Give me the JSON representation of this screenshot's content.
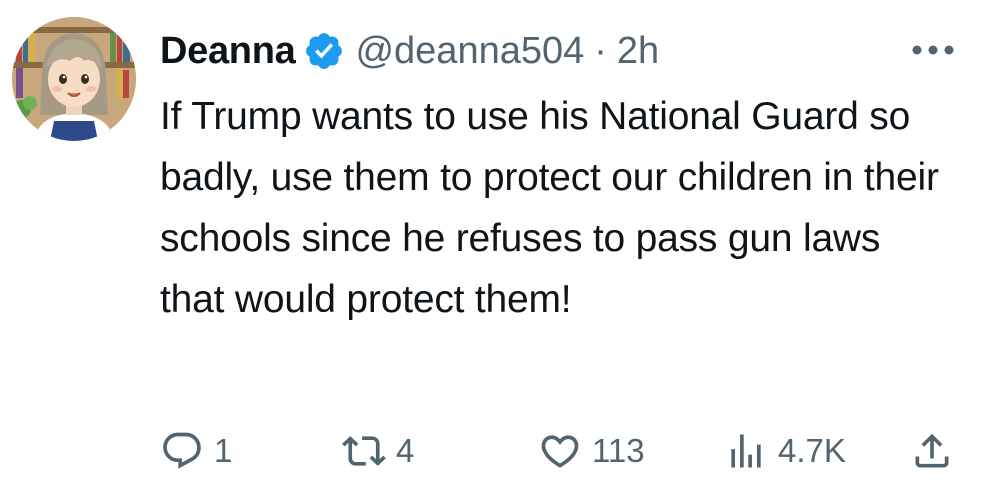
{
  "tweet": {
    "author": {
      "display_name": "Deanna",
      "handle": "@deanna504",
      "verified": true,
      "verified_color": "#1d9bf0"
    },
    "separator": "·",
    "time": "2h",
    "text": "If Trump wants to use his National Guard so badly, use them to protect our children in their schools since he refuses to pass gun laws that would protect them!",
    "actions": {
      "replies": "1",
      "reposts": "4",
      "likes": "113",
      "views": "4.7K"
    },
    "icons": [
      "more-icon",
      "reply-icon",
      "repost-icon",
      "like-icon",
      "views-icon",
      "share-icon"
    ]
  }
}
